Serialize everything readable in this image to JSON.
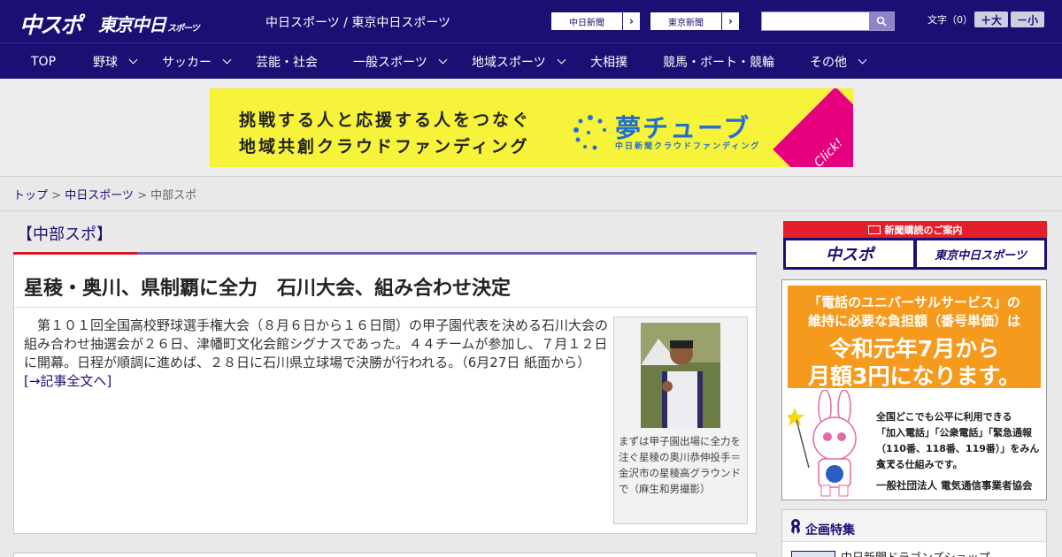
{
  "header": {
    "logo_chuspo": "中スポ",
    "logo_tokyo": "東京中日",
    "logo_tokyo_small": "スポーツ",
    "top_link": "中日スポーツ / 東京中日スポーツ",
    "ext_links": [
      {
        "label": "中日新聞",
        "arrow": "›"
      },
      {
        "label": "東京新聞",
        "arrow": "›"
      }
    ],
    "search": {
      "value": "",
      "placeholder": ""
    },
    "font_size_label": "文字（0）",
    "font_plus": "＋大",
    "font_minus": "－小"
  },
  "nav": [
    {
      "label": "TOP",
      "dropdown": false
    },
    {
      "label": "野球",
      "dropdown": true
    },
    {
      "label": "サッカー",
      "dropdown": true
    },
    {
      "label": "芸能・社会",
      "dropdown": false
    },
    {
      "label": "一般スポーツ",
      "dropdown": true
    },
    {
      "label": "地域スポーツ",
      "dropdown": true
    },
    {
      "label": "大相撲",
      "dropdown": false
    },
    {
      "label": "競馬・ボート・競輪",
      "dropdown": false
    },
    {
      "label": "その他",
      "dropdown": true
    }
  ],
  "banner": {
    "line1": "挑戦する人と応援する人をつなぐ",
    "line2": "地域共創クラウドファンディング",
    "brand": "夢チューブ",
    "brand_sub": "中日新聞クラウドファンディング",
    "click": "Click!",
    "background": "#f7f33a"
  },
  "breadcrumb": {
    "items": [
      "トップ",
      "中日スポーツ"
    ],
    "current": "中部スポ",
    "separator": " > "
  },
  "section": {
    "title": "【中部スポ】"
  },
  "article": {
    "title": "星稜・奥川、県制覇に全力　石川大会、組み合わせ決定",
    "body": "第１０１回全国高校野球選手権大会（８月６日から１６日間）の甲子園代表を決める石川大会の組み合わせ抽選会が２６日、津幡町文化会館シグナスであった。４４チームが参加し、７月１２日に開幕。日程が順調に進めば、２８日に石川県立球場で決勝が行われる。（6月27日 紙面から）",
    "more": "[→記事全文へ]",
    "photo_caption": "まずは甲子園出場に全力を注ぐ星稜の奥川恭伸投手＝金沢市の星稜高グラウンドで（麻生和男撮影）"
  },
  "sidebar": {
    "subscribe_head": "新聞購読のご案内",
    "subscribe_buttons": [
      "中スポ",
      "東京中日スポーツ"
    ],
    "ad_lines": [
      "「電話のユニバーサルサービス」の",
      "維持に必要な負担額（番号単価）は",
      "令和元年7月から",
      "月額3円になります。"
    ],
    "ad_text": [
      "全国どこでも公平に利用できる",
      "「加入電話」「公衆電話」「緊急通報",
      "（110番、118番、119番）」をみんなで",
      "支える仕組みです。"
    ],
    "ad_org": "一般社団法人 電気通信事業者協会",
    "feature_title": "企画特集",
    "feature_item": "中日新聞ドラゴンズショップ"
  },
  "colors": {
    "header_bg": "#1a0f73",
    "accent_red": "#d4161f",
    "link": "#1a0f73"
  }
}
